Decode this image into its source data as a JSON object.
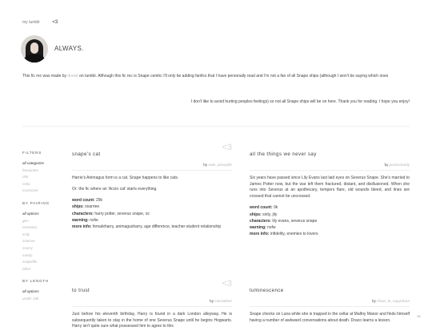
{
  "nav": {
    "my_tumblr": "my tumblr",
    "heart": "<3"
  },
  "site": {
    "title": "ALWAYS."
  },
  "intro": {
    "line1_before": "This fic rec was made by ",
    "line1_link": "doesit",
    "line1_after": " on tumblr. Although this fic rec is Snape centric I'll only be adding fanfics that I have personally read and I'm not a fan of all Snape ships (although I won't be saying which ones",
    "line2": "I don't like to avoid hurting peoples feelings) so not all Snape ships will be on here. Thank you for reading. I hope you enjoy!"
  },
  "sidebar": {
    "filters_heading": "FILTERS",
    "filters": [
      "all categories",
      "favourites",
      "ofw",
      "nsfw",
      "crossover"
    ],
    "pairing_heading": "BY PAIRING",
    "pairings": [
      "all options",
      "gen",
      "severitus",
      "snily",
      "snarree",
      "snarry",
      "sandy",
      "snapeflix",
      "other"
    ],
    "length_heading": "BY LENGTH",
    "lengths": [
      "all options",
      "under 10k"
    ]
  },
  "labels": {
    "by": "by",
    "word_count": "word count:",
    "ships": "ships:",
    "characters": "characters:",
    "warning": "warning:",
    "more_info": "more info:"
  },
  "fics": [
    {
      "title": "snape's cat",
      "heart": "<3",
      "author": "eate_amaryllis",
      "summary": [
        "Harrie's Animagus form is a cat. Snape happens to like cats.",
        "Or: the fic where an 'Accio cat' starts everything."
      ],
      "word_count": "29k",
      "ships": "snarriee",
      "characters": "harry potter, severus snape, oc",
      "warning": "nsfw",
      "more_info": "femaleharry, animagusharry, age difference, teacher-student relationship"
    },
    {
      "title": "all the things we never say",
      "heart": "",
      "author": "pecturnoody",
      "summary": [
        "Six years have passed since Lily Evans last laid eyes on Severus Snape. She's married to James Potter now, but the war left them fractured, distant, and disillusioned. When she runs into Severus at an apothecary, tempers flare, old wounds bleed, and lines are crossed that cannot be uncrossed."
      ],
      "word_count": "9k",
      "ships": "snily, jily",
      "characters": "lily evans, severus snape",
      "warning": "nsfw",
      "more_info": "infidelity, enemies to lovers"
    },
    {
      "title": "to trust",
      "heart": "<3",
      "author": "caeradeon",
      "summary": [
        "Just before his eleventh birthday, Harry is found in a dark London alleyway. He is subsequently taken to stay in the home of one Severus Snape until he begins Hogwarts. Harry isn't quite sure what possessed him to agree to this"
      ]
    },
    {
      "title": "luminescence",
      "heart": "",
      "author": "clean_la_capychara",
      "summary": [
        "Snape checks on Luna while she is trapped in the cellar at Malfoy Manor and finds himself having a number of awkward conversations about death. Draco learns a lesson."
      ]
    }
  ],
  "corner": "sc"
}
